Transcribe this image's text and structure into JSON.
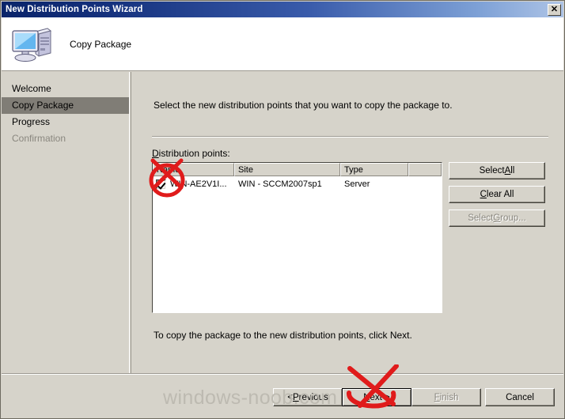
{
  "window": {
    "title": "New Distribution Points Wizard",
    "close_label": "✕"
  },
  "header": {
    "title": "Copy Package",
    "icon": "computer-icon"
  },
  "sidebar": {
    "items": [
      {
        "label": "Welcome",
        "state": "normal"
      },
      {
        "label": "Copy Package",
        "state": "selected"
      },
      {
        "label": "Progress",
        "state": "normal"
      },
      {
        "label": "Confirmation",
        "state": "disabled"
      }
    ]
  },
  "main": {
    "instruction": "Select the new distribution points that you want to copy the package to.",
    "list_label_prefix": "D",
    "list_label_rest": "istribution points:",
    "bottom_note": "To copy the package to the new distribution points, click Next.",
    "table": {
      "columns": [
        "Name",
        "Site",
        "Type",
        ""
      ],
      "rows": [
        {
          "checked": true,
          "name": "WIN-AE2V1I...",
          "site": "WIN - SCCM2007sp1",
          "type": "Server"
        }
      ]
    },
    "side_buttons": [
      {
        "pre": "Select ",
        "accel": "A",
        "post": "ll",
        "enabled": true
      },
      {
        "pre": "",
        "accel": "C",
        "post": "lear All",
        "enabled": true
      },
      {
        "pre": "Select ",
        "accel": "G",
        "post": "roup...",
        "enabled": false
      }
    ]
  },
  "footer": {
    "buttons": [
      {
        "id": "btn-previous",
        "pre": "< ",
        "accel": "P",
        "post": "revious",
        "enabled": true,
        "default": false
      },
      {
        "id": "btn-next",
        "pre": "",
        "accel": "N",
        "post": "ext >",
        "enabled": true,
        "default": true
      },
      {
        "id": "btn-finish",
        "pre": "",
        "accel": "F",
        "post": "inish",
        "enabled": false,
        "default": false
      },
      {
        "id": "btn-cancel",
        "pre": "Cancel",
        "accel": "",
        "post": "",
        "enabled": true,
        "default": false
      }
    ]
  },
  "watermark": {
    "text": "windows-noob.com"
  },
  "annotations": {
    "checkbox_circle": "red-circle-slash-annotation",
    "next_mark": "red-circle-x-annotation"
  },
  "colors": {
    "title_left": "#0a246a",
    "title_right": "#aec4e6",
    "dialog_face": "#d6d3ca",
    "selected_nav": "#807d76",
    "annotation_red": "#e01b1b",
    "watermark": "#bdbab1"
  }
}
